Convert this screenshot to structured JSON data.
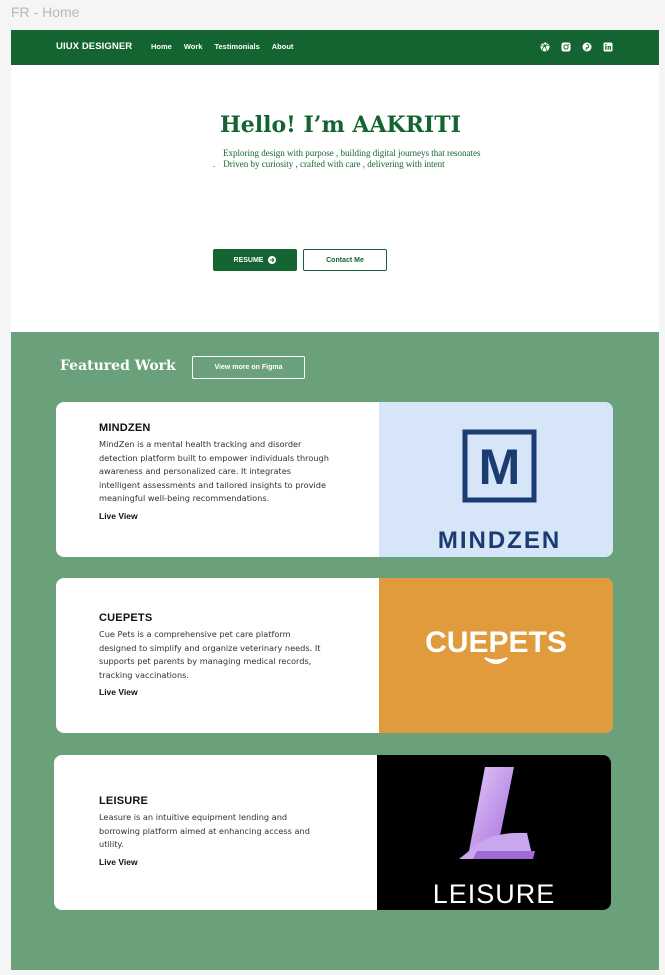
{
  "frame": {
    "label": "FR - Home"
  },
  "nav": {
    "brand": "UIUX DESIGNER",
    "links": [
      "Home",
      "Work",
      "Testimonials",
      "About"
    ],
    "social_icons": [
      "dribbble-icon",
      "instagram-icon",
      "pinterest-icon",
      "linkedin-icon"
    ]
  },
  "hero": {
    "title": "Hello! I’m AAKRITI",
    "subtitle_line1": "Exploring design with purpose , building digital journeys that resonates",
    "subtitle_line2_dot": ".",
    "subtitle_line2": "Driven by curiosity , crafted with care , delivering with intent",
    "resume_label": "RESUME",
    "contact_label": "Contact Me"
  },
  "featured": {
    "title": "Featured Work",
    "figma_label": "View more on Figma",
    "projects": [
      {
        "title": "MINDZEN",
        "description": "MindZen is a mental health tracking and disorder detection platform built to empower individuals through awareness and personalized care. It integrates intelligent assessments and tailored insights to provide meaningful well-being recommendations.",
        "link": "Live View",
        "logo_letter": "M",
        "logo_text": "MINDZEN",
        "bg_color": "#d6e5f7",
        "logo_color": "#1b3b73"
      },
      {
        "title": "CUEPETS",
        "description": "Cue Pets is a comprehensive pet care platform designed to simplify and organize veterinary needs. It supports pet parents by managing medical records, tracking vaccinations.",
        "link": "Live View",
        "logo_text": "CUEPETS",
        "bg_color": "#e09b3d",
        "logo_color": "#ffffff"
      },
      {
        "title": "LEISURE",
        "description": "Leasure is an intuitive equipment lending and borrowing platform aimed at enhancing access and utility.",
        "link": "Live View",
        "logo_text": "LEISURE",
        "bg_color": "#000000",
        "logo_color": "#ffffff",
        "accent_color": "#c9a6ee"
      }
    ]
  },
  "colors": {
    "primary": "#146431",
    "featured_bg": "#6aa17b"
  }
}
